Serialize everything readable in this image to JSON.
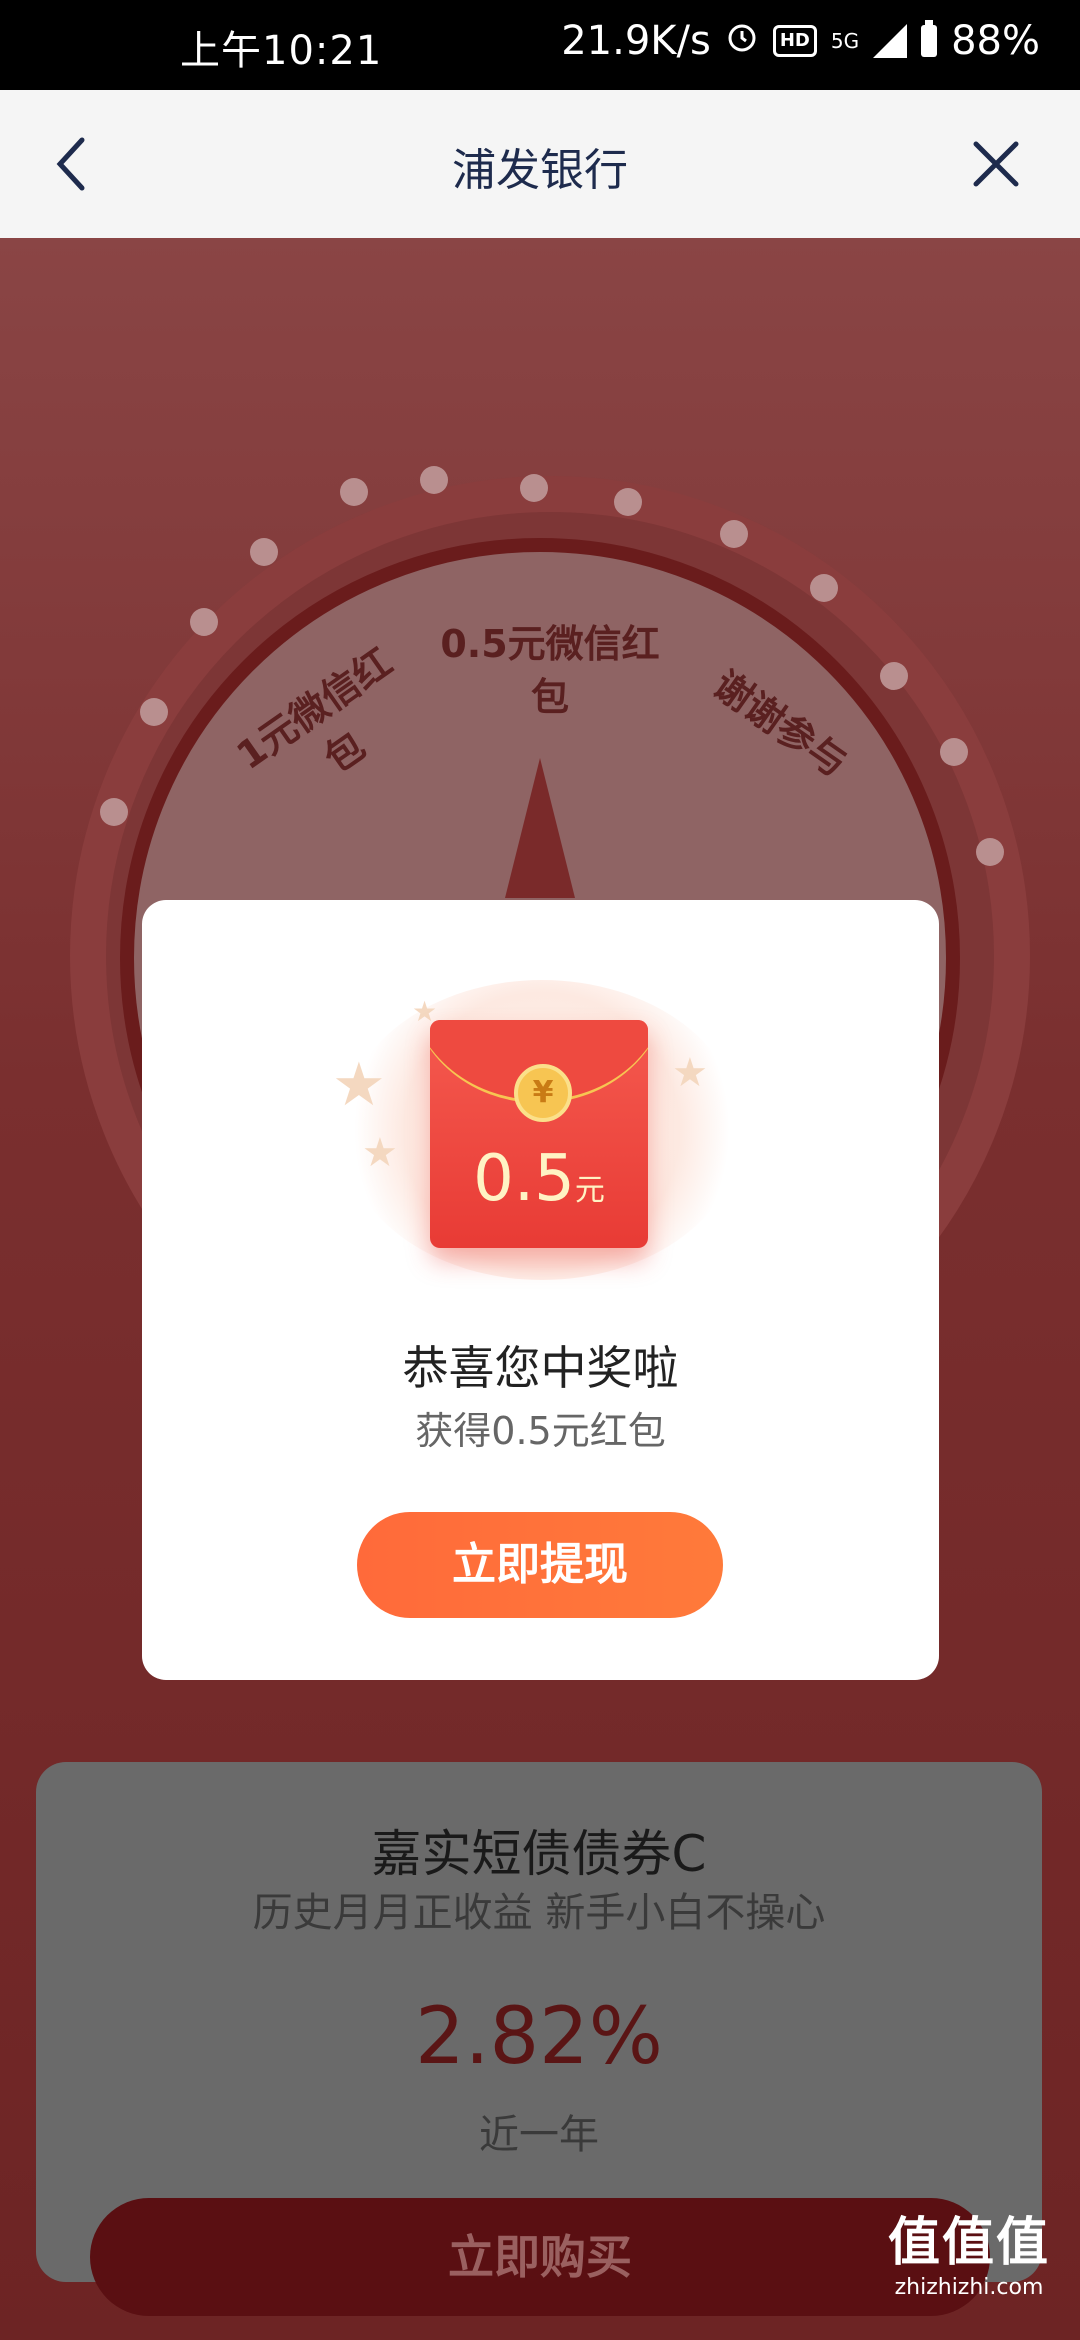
{
  "status_bar": {
    "time": "上午10:21",
    "speed": "21.9K/s",
    "hd": "HD",
    "network": "5G",
    "battery": "88%"
  },
  "nav": {
    "title": "浦发银行",
    "back_icon": "chevron-left-icon",
    "close_icon": "close-icon"
  },
  "wheel": {
    "segments": [
      "1元微信红包",
      "0.5元微信红包",
      "谢谢参与"
    ]
  },
  "modal": {
    "amount": "0.5",
    "unit": "元",
    "coin_symbol": "¥",
    "title": "恭喜您中奖啦",
    "subtitle": "获得0.5元红包",
    "cta": "立即提现"
  },
  "product_card": {
    "name": "嘉实短债债券C",
    "slogan": "历史月月正收益 新手小白不操心",
    "rate": "2.82%",
    "rate_label": "近一年",
    "buy_button": "立即购买"
  },
  "watermark": {
    "logo": "值值值",
    "site": "zhizhizhi.com"
  },
  "colors": {
    "accent": "#ff6a3a",
    "envelope": "#e83b35",
    "nav_title": "#1e2b4d"
  }
}
